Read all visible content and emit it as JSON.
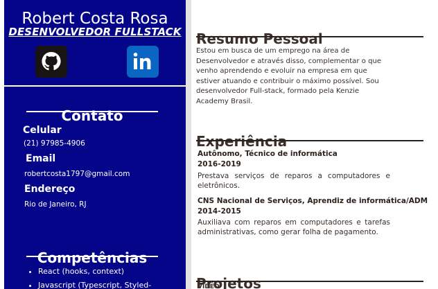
{
  "sidebar": {
    "name": "Robert Costa Rosa",
    "role": "DESENVOLVEDOR FULLSTACK",
    "social": [
      {
        "icon": "github-icon"
      },
      {
        "icon": "linkedin-icon"
      }
    ],
    "contact": {
      "title": "Contato",
      "phone_label": "Celular",
      "phone_value": "(21) 97985-4906",
      "email_label": "Email",
      "email_value": "robertcosta1797@gmail.com",
      "address_label": "Endereço",
      "address_value": "Rio de Janeiro, RJ"
    },
    "skills": {
      "title": "Competências",
      "items": [
        "React (hooks, context)",
        "Javascript (Typescript, Styled-"
      ]
    }
  },
  "main": {
    "summary": {
      "title": "Resumo Pessoal",
      "text": "Estou em busca de um emprego na área de Desenvolvedor e através disso, complementar o que venho aprendendo e evoluir na empresa em que estiver atuando e contribuir o máximo possível. Sou desenvolvedor Full-stack, formado pela Kenzie Academy Brasil."
    },
    "experience": {
      "title": "Experiência",
      "jobs": [
        {
          "title": "Autônomo, Técnico de informática",
          "period": "2016-2019",
          "description": "Prestava serviços de reparos a computadores e eletrônicos."
        },
        {
          "title": "CNS Nacional de Serviços, Aprendiz de informática/ADM",
          "period": "2014-2015",
          "description": "Auxiliava com reparos em computadores e tarefas administrativas, como gerar folha de pagamento."
        }
      ]
    },
    "projects": {
      "title": "Projetos",
      "cropped_text": "VIDEO"
    }
  },
  "colors": {
    "sidebar_background": "#05058a",
    "page_background": "#ffffff",
    "text_dark": "#3a2f2a",
    "rule": "#2d211c",
    "github_tile": "#181414",
    "linkedin_tile": "#0a66c2"
  }
}
